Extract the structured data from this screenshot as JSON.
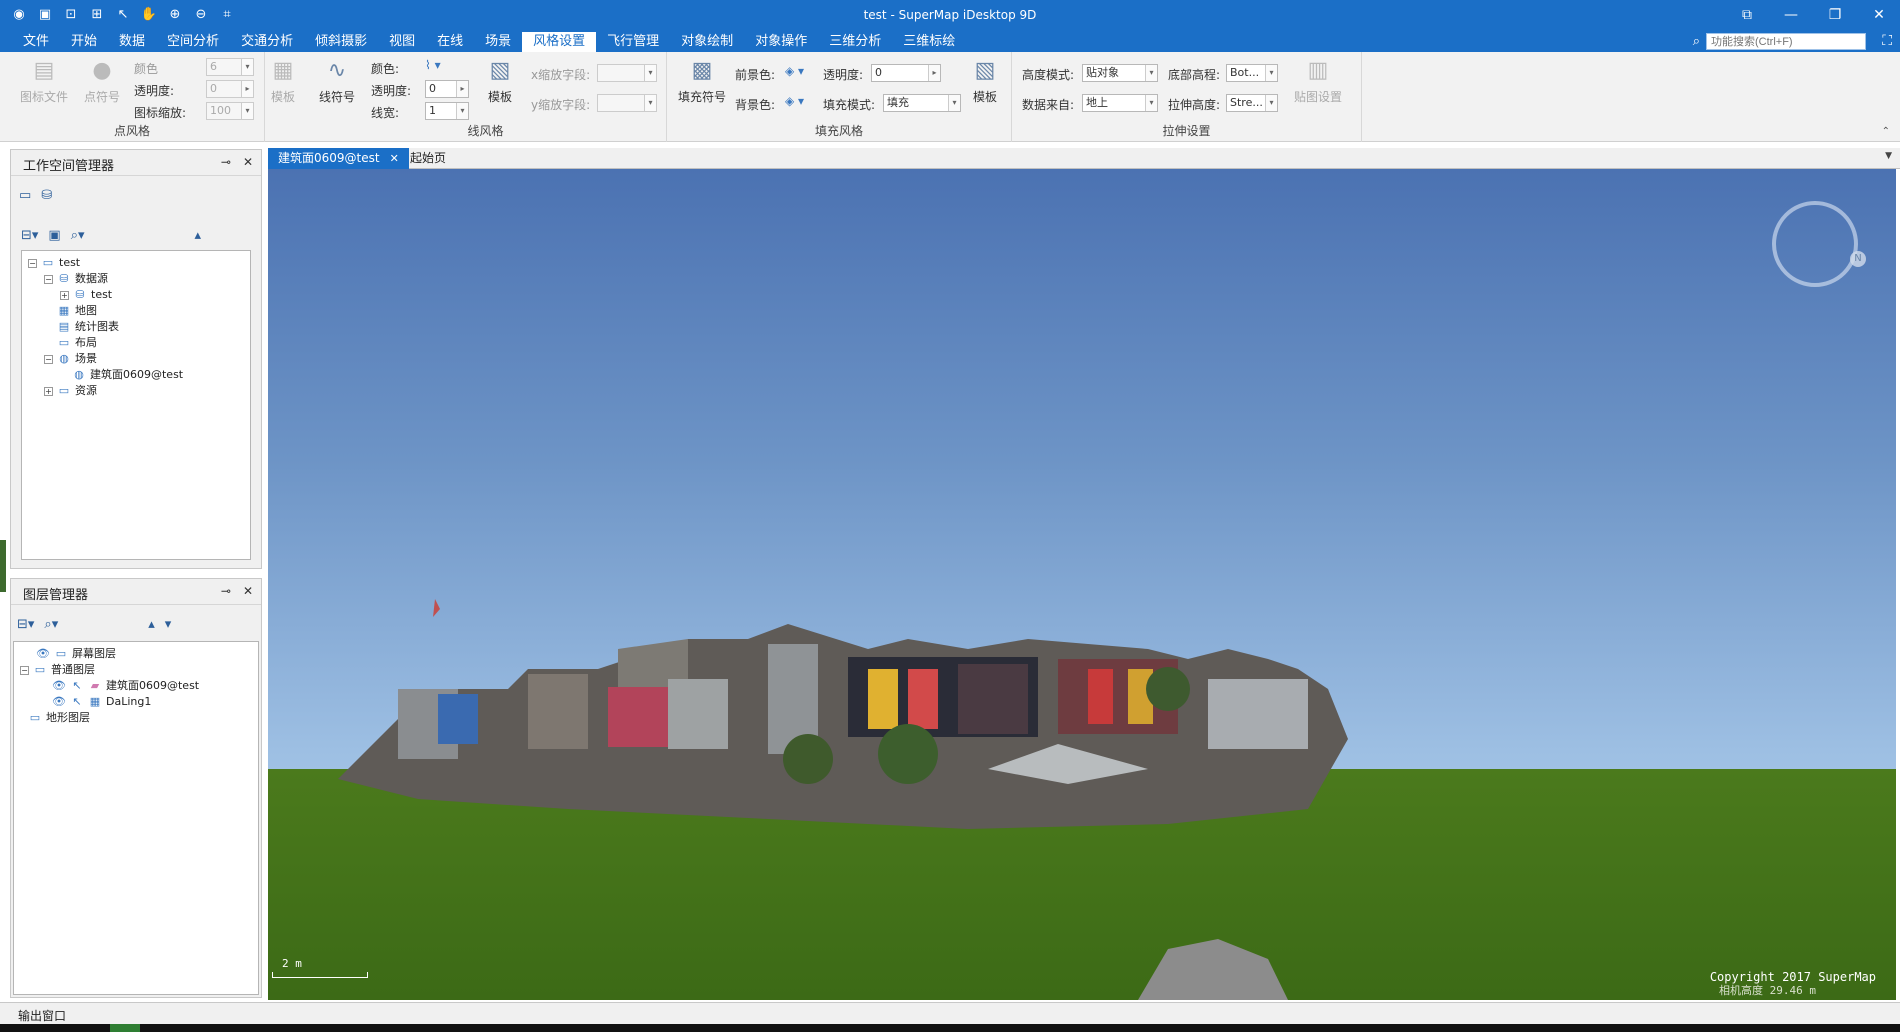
{
  "window": {
    "title": "test - SuperMap iDesktop 9D",
    "quick_access": [
      "app-logo-icon",
      "save-icon",
      "new-icon",
      "open-icon",
      "select-icon",
      "pan-icon",
      "zoom-in-icon",
      "zoom-out-icon",
      "full-extent-icon"
    ],
    "controls": [
      "restore-layout-icon",
      "minimize-icon",
      "maximize-icon",
      "close-icon"
    ]
  },
  "menu": {
    "tabs": [
      "文件",
      "开始",
      "数据",
      "空间分析",
      "交通分析",
      "倾斜摄影",
      "视图",
      "在线",
      "场景",
      "风格设置",
      "飞行管理",
      "对象绘制",
      "对象操作",
      "三维分析",
      "三维标绘"
    ],
    "active": "风格设置",
    "search_placeholder": "功能搜索(Ctrl+F)"
  },
  "ribbon": {
    "point_style": {
      "label": "点风格",
      "icon_file": "图标文件",
      "point_symbol": "点符号",
      "color_label": "颜色",
      "color_size": "6",
      "transparency_label": "透明度:",
      "transparency_value": "0",
      "icon_scale_label": "图标缩放:",
      "icon_scale_value": "100",
      "template": "模板"
    },
    "line_style": {
      "label": "线风格",
      "line_symbol": "线符号",
      "color_label": "颜色:",
      "transparency_label": "透明度:",
      "transparency_value": "0",
      "width_label": "线宽:",
      "width_value": "1",
      "template": "模板",
      "x_scale_label": "x缩放字段:",
      "y_scale_label": "y缩放字段:"
    },
    "fill_style": {
      "label": "填充风格",
      "fill_symbol": "填充符号",
      "fg_label": "前景色:",
      "bg_label": "背景色:",
      "transparency_label": "透明度:",
      "transparency_value": "0",
      "fill_mode_label": "填充模式:",
      "fill_mode_value": "填充",
      "template": "模板"
    },
    "extrude": {
      "label": "拉伸设置",
      "height_mode_label": "高度模式:",
      "height_mode_value": "贴对象",
      "bottom_label": "底部高程:",
      "bottom_value": "Bot...",
      "data_from_label": "数据来自:",
      "data_from_value": "地上",
      "extrude_label": "拉伸高度:",
      "extrude_value": "Stre...",
      "texture": "贴图设置"
    }
  },
  "workspace": {
    "title": "工作空间管理器",
    "tree": {
      "root": "test",
      "datasource": "数据源",
      "ds_test": "test",
      "map": "地图",
      "chart": "统计图表",
      "layout": "布局",
      "scene": "场景",
      "scene_item": "建筑面0609@test",
      "resource": "资源"
    }
  },
  "layers": {
    "title": "图层管理器",
    "tree": {
      "screen": "屏幕图层",
      "normal": "普通图层",
      "layer1": "建筑面0609@test",
      "layer2": "DaLing1",
      "terrain": "地形图层"
    }
  },
  "doc_tabs": {
    "active": "建筑面0609@test",
    "other": "起始页"
  },
  "scene": {
    "copyright": "Copyright 2017 SuperMap",
    "camera_height": "相机高度 29.46 m",
    "scale": "2 m"
  },
  "status": {
    "output_tab": "输出窗口"
  }
}
